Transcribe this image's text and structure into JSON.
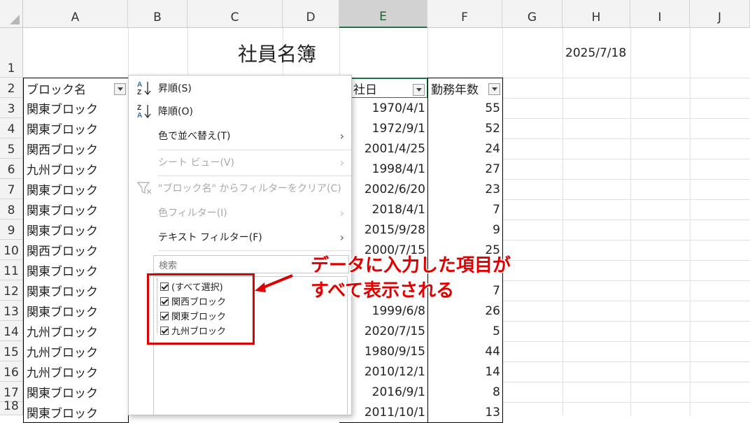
{
  "columns": [
    "A",
    "B",
    "C",
    "D",
    "E",
    "F",
    "G",
    "H",
    "I",
    "J"
  ],
  "selected_column": "E",
  "rows": [
    "1",
    "2",
    "3",
    "4",
    "5",
    "6",
    "7",
    "8",
    "9",
    "10",
    "11",
    "12",
    "13",
    "14",
    "15",
    "16",
    "17",
    "18"
  ],
  "title": "社員名簿",
  "date": "2025/7/18",
  "headers": {
    "block": "ブロック名",
    "join": "社日",
    "years": "勤務年数"
  },
  "records": [
    {
      "block": "関東ブロック",
      "join": "1970/4/1",
      "years": "55"
    },
    {
      "block": "関東ブロック",
      "join": "1972/9/1",
      "years": "52"
    },
    {
      "block": "関西ブロック",
      "join": "2001/4/25",
      "years": "24"
    },
    {
      "block": "九州ブロック",
      "join": "1998/4/1",
      "years": "27"
    },
    {
      "block": "関東ブロック",
      "join": "2002/6/20",
      "years": "23"
    },
    {
      "block": "関東ブロック",
      "join": "2018/4/1",
      "years": "7"
    },
    {
      "block": "関東ブロック",
      "join": "2015/9/28",
      "years": "9"
    },
    {
      "block": "関西ブロック",
      "join": "2000/7/15",
      "years": "25"
    },
    {
      "block": "関東ブロック",
      "join": "",
      "years": ""
    },
    {
      "block": "関東ブロック",
      "join": "",
      "years": "7"
    },
    {
      "block": "関東ブロック",
      "join": "1999/6/8",
      "years": "26"
    },
    {
      "block": "九州ブロック",
      "join": "2020/7/15",
      "years": "5"
    },
    {
      "block": "九州ブロック",
      "join": "1980/9/15",
      "years": "44"
    },
    {
      "block": "九州ブロック",
      "join": "2010/12/1",
      "years": "14"
    },
    {
      "block": "関東ブロック",
      "join": "2016/9/1",
      "years": "8"
    },
    {
      "block": "関東ブロック",
      "join": "2011/10/1",
      "years": "13"
    }
  ],
  "menu": {
    "sort_asc": "昇順(S)",
    "sort_desc": "降順(O)",
    "sort_by_color": "色で並べ替え(T)",
    "sheet_view": "シート ビュー(V)",
    "clear_filter": "\"ブロック名\" からフィルターをクリア(C)",
    "color_filter": "色フィルター(I)",
    "text_filter": "テキスト フィルター(F)",
    "search_placeholder": "検索",
    "list_items": [
      "(すべて選択)",
      "関西ブロック",
      "関東ブロック",
      "九州ブロック"
    ]
  },
  "annotation": {
    "line1": "データに入力した項目が",
    "line2": "すべて表示される",
    "color": "#e00000"
  },
  "icons": [
    "sort-ascending-icon",
    "sort-descending-icon",
    "submenu-arrow-icon",
    "clear-filter-icon",
    "filter-dropdown-icon",
    "red-arrow-icon"
  ]
}
